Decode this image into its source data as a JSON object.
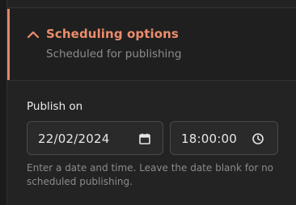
{
  "section": {
    "title": "Scheduling options",
    "subtitle": "Scheduled for publishing",
    "expanded": true,
    "toggle_icon": "chevron-up-icon"
  },
  "publish_on": {
    "label": "Publish on",
    "date_value": "22/02/2024",
    "date_icon": "calendar-icon",
    "time_value": "18:00:00",
    "time_icon": "clock-icon",
    "help_text": "Enter a date and time. Leave the date blank for no scheduled publishing."
  },
  "colors": {
    "accent": "#e0876a",
    "title": "#ec8d6c",
    "background": "#232323"
  }
}
